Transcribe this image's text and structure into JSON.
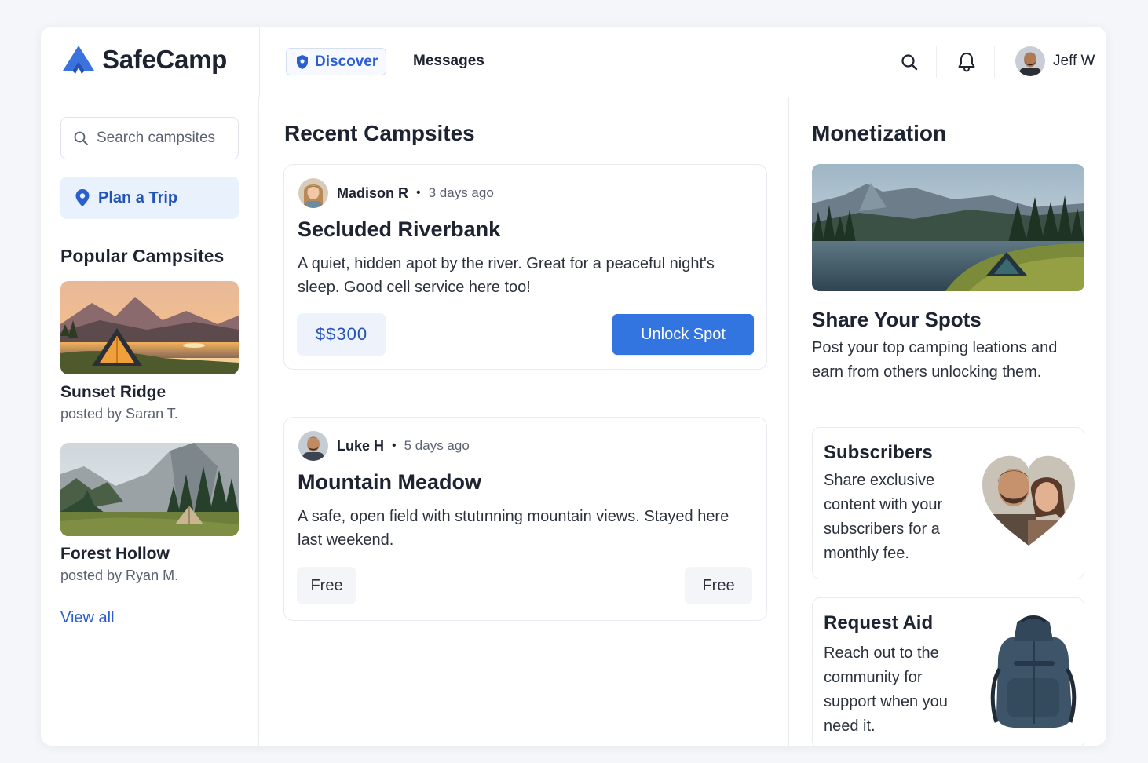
{
  "brand": {
    "name": "SafeCamp"
  },
  "nav": {
    "discover": "Discover",
    "messages": "Messages"
  },
  "user": {
    "name": "Jeff W"
  },
  "sidebar": {
    "search_placeholder": "Search campsites",
    "plan_trip": "Plan a Trip",
    "popular_heading": "Popular Campsites",
    "popular": [
      {
        "title": "Sunset Ridge",
        "posted_by": "posted by Saran T."
      },
      {
        "title": "Forest Hollow",
        "posted_by": "posted by Ryan M."
      }
    ],
    "view_all": "View all"
  },
  "main": {
    "heading": "Recent Campsites",
    "posts": [
      {
        "author": "Madison R",
        "time": "3 days ago",
        "title": "Secluded Riverbank",
        "description": "A quiet, hidden apot by the river. Great for a peaceful night's sleep. Good cell service here too!",
        "price": "$$300",
        "action": "Unlock Spot"
      },
      {
        "author": "Luke H",
        "time": "5 days ago",
        "title": "Mountain Meadow",
        "description": "A safe, open field with stutınning mountain views. Stayed here last weekend.",
        "price_left": "Free",
        "price_right": "Free"
      }
    ]
  },
  "monetization": {
    "heading": "Monetization",
    "share_title": "Share Your Spots",
    "share_desc": "Post your top camping leations and earn from others unlocking them.",
    "cards": [
      {
        "title": "Subscribers",
        "desc": "Share exclusive content with your subscribers for a monthly fee."
      },
      {
        "title": "Request Aid",
        "desc": "Reach out to the community for support when you need it."
      }
    ]
  },
  "colors": {
    "accent": "#3274e0",
    "accent_text": "#2b5fd0",
    "accent_bg": "#e9f1fd"
  }
}
